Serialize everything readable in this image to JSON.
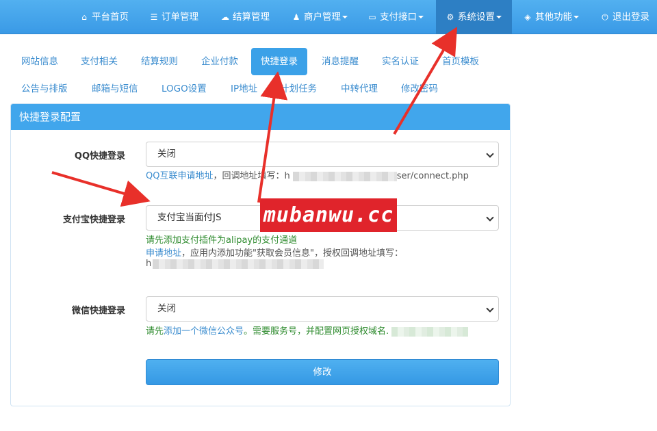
{
  "navbar": {
    "items": [
      {
        "label": "平台首页",
        "icon": "home-icon",
        "caret": false,
        "active": false
      },
      {
        "label": "订单管理",
        "icon": "list-icon",
        "caret": false,
        "active": false
      },
      {
        "label": "结算管理",
        "icon": "cloud-icon",
        "caret": false,
        "active": false
      },
      {
        "label": "商户管理",
        "icon": "user-icon",
        "caret": true,
        "active": false
      },
      {
        "label": "支付接口",
        "icon": "card-icon",
        "caret": true,
        "active": false
      },
      {
        "label": "系统设置",
        "icon": "gear-icon",
        "caret": true,
        "active": true
      },
      {
        "label": "其他功能",
        "icon": "cube-icon",
        "caret": true,
        "active": false
      },
      {
        "label": "退出登录",
        "icon": "power-icon",
        "caret": false,
        "active": false
      }
    ]
  },
  "tabs": {
    "row1": [
      "网站信息",
      "支付相关",
      "结算规则",
      "企业付款",
      "快捷登录",
      "消息提醒",
      "实名认证",
      "首页模板"
    ],
    "row2": [
      "公告与排版",
      "邮箱与短信",
      "LOGO设置",
      "IP地址",
      "计划任务",
      "中转代理",
      "修改密码"
    ],
    "active": "快捷登录"
  },
  "panel": {
    "title": "快捷登录配置",
    "qq": {
      "label": "QQ快捷登录",
      "value": "关闭",
      "help_link": "QQ互联申请地址",
      "help_text": "，回调地址填写：",
      "help_prefix": "h",
      "help_suffix": "ser/connect.php"
    },
    "alipay": {
      "label": "支付宝快捷登录",
      "value": "支付宝当面付JS",
      "notice": "请先添加支付插件为alipay的支付通道",
      "help_link": "申请地址",
      "help_text": "，应用内添加功能\"获取会员信息\"，授权回调地址填写：",
      "help_prefix": "h"
    },
    "wechat": {
      "label": "微信快捷登录",
      "value": "关闭",
      "notice_prefix": "请先",
      "notice_link": "添加一个微信公众号",
      "notice_suffix": "。需要服务号，并配置网页授权域名."
    },
    "submit_label": "修改"
  },
  "watermark": "mubanwu.cc",
  "colors": {
    "navbar": "#3a9ae6",
    "active_nav": "#2d7fc4",
    "link": "#3c8dcf",
    "notice_green": "#2e8b2e",
    "annotation_red": "#e8302a"
  }
}
